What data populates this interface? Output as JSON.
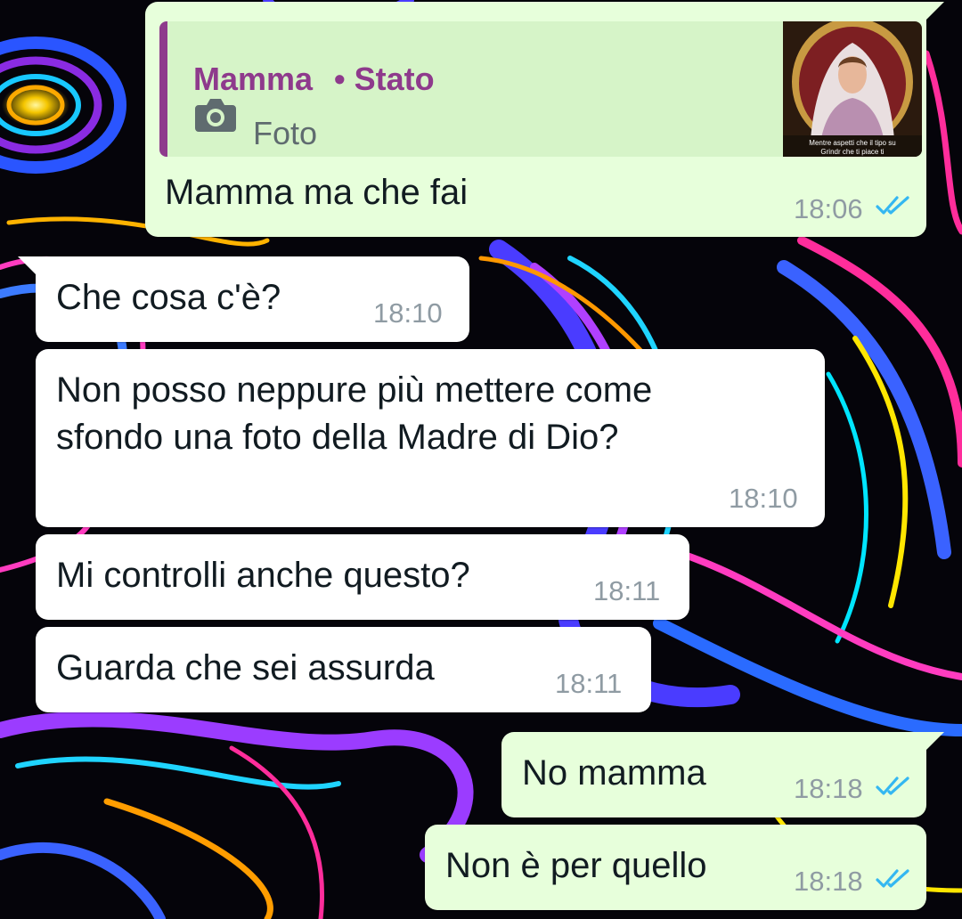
{
  "colors": {
    "incoming_bubble": "#ffffff",
    "outgoing_bubble": "#e7ffdb",
    "quote_accent": "#8e3a8c",
    "read_ticks": "#34b7f1",
    "timestamp": "#8f9ba3"
  },
  "reply": {
    "author": "Mamma",
    "status_label": "• Stato",
    "media_icon": "camera-icon",
    "media_type": "Foto",
    "thumbnail_caption": "Mentre aspetti che il tipo su Grindr che ti piace ti"
  },
  "messages": [
    {
      "direction": "out",
      "text": "Mamma ma che fai",
      "time": "18:06",
      "status": "read"
    },
    {
      "direction": "in",
      "text": "Che cosa c'è?",
      "time": "18:10"
    },
    {
      "direction": "in",
      "text": "Non posso neppure più mettere come\nsfondo una foto della Madre di Dio?",
      "time": "18:10"
    },
    {
      "direction": "in",
      "text": "Mi controlli anche questo?",
      "time": "18:11"
    },
    {
      "direction": "in",
      "text": "Guarda che sei assurda",
      "time": "18:11"
    },
    {
      "direction": "out",
      "text": "No mamma",
      "time": "18:18",
      "status": "read"
    },
    {
      "direction": "out",
      "text": "Non è per quello",
      "time": "18:18",
      "status": "read"
    }
  ]
}
